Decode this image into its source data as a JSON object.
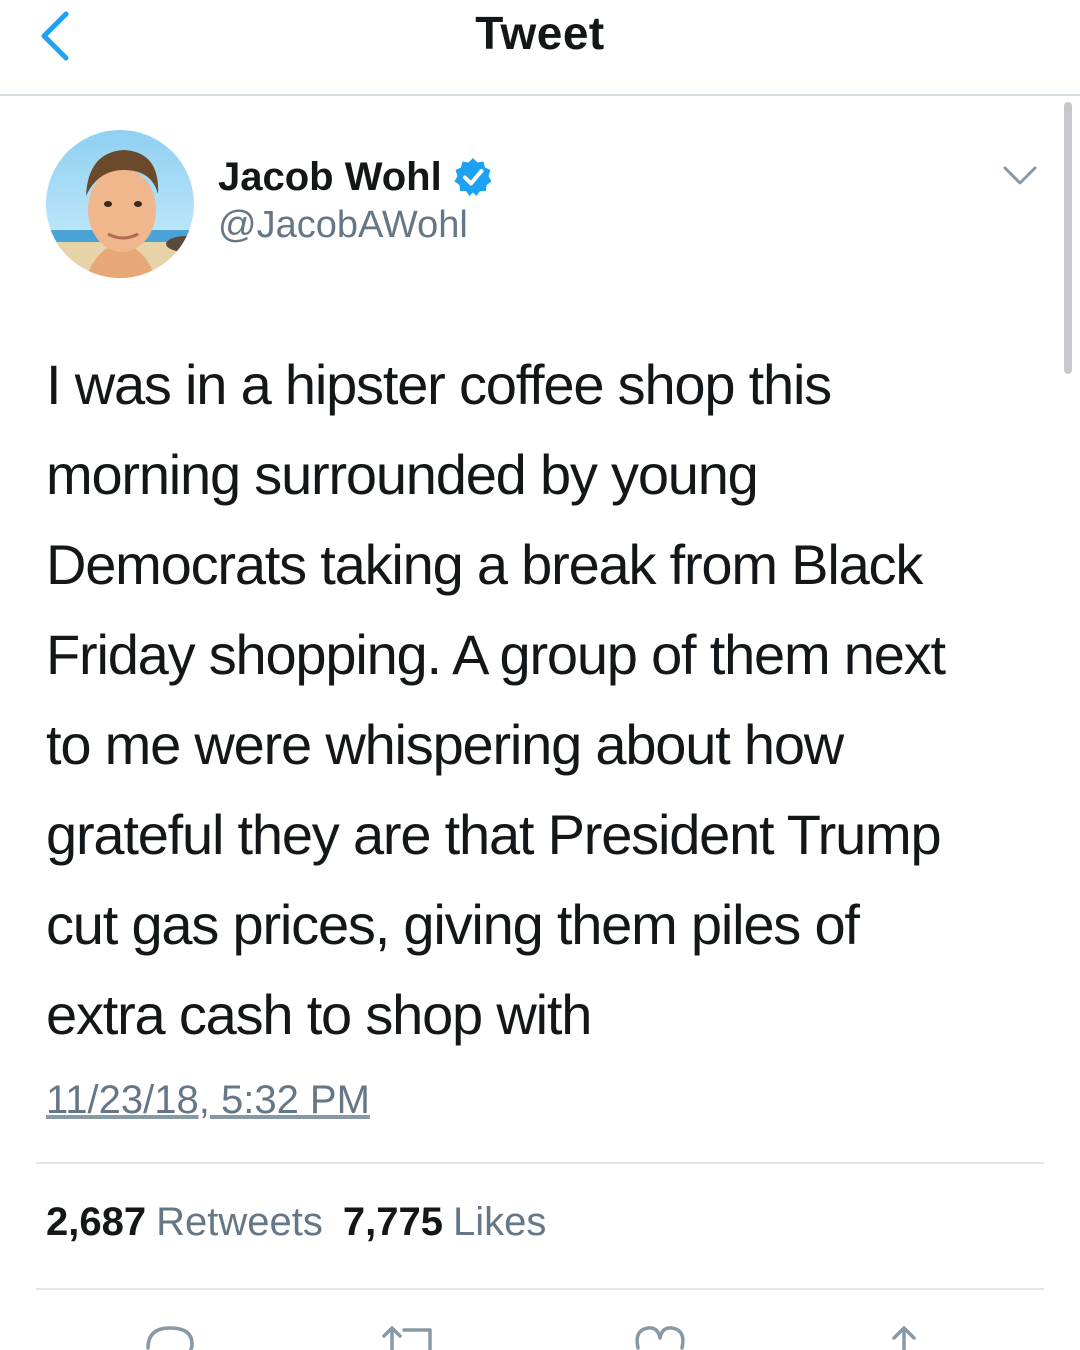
{
  "nav": {
    "title": "Tweet",
    "back_icon": "chevron-left-icon"
  },
  "user": {
    "name": "Jacob Wohl",
    "handle": "@JacobAWohl",
    "verified": true,
    "verified_color": "#1da1f2"
  },
  "tweet": {
    "lines": [
      "I was in a hipster coffee shop this",
      "morning surrounded by young",
      "Democrats taking a break from Black",
      "Friday shopping. A group of them next",
      "to me were whispering about how",
      "grateful they are that President Trump",
      "cut gas prices, giving them piles of",
      "extra cash to shop with"
    ],
    "timestamp": "11/23/18, 5:32 PM"
  },
  "stats": {
    "retweets_count": "2,687",
    "retweets_label": "Retweets",
    "likes_count": "7,775",
    "likes_label": "Likes"
  },
  "actions": [
    "reply-icon",
    "retweet-icon",
    "like-icon",
    "share-icon"
  ],
  "colors": {
    "accent": "#1da1f2",
    "text": "#14171a",
    "secondary": "#657786",
    "divider": "#e1e8ed"
  }
}
